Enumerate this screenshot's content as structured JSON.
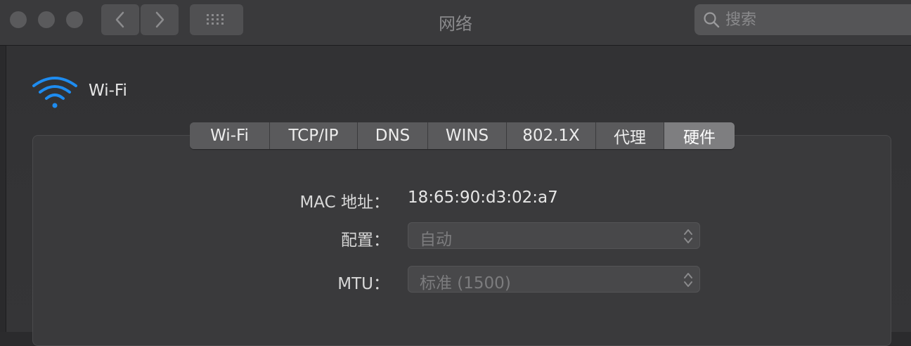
{
  "window": {
    "title": "网络",
    "search_placeholder": "搜索"
  },
  "interface": {
    "name": "Wi-Fi",
    "icon": "wifi-icon",
    "accent_color": "#1e8cf0"
  },
  "tabs": [
    {
      "label": "Wi-Fi",
      "active": false
    },
    {
      "label": "TCP/IP",
      "active": false
    },
    {
      "label": "DNS",
      "active": false
    },
    {
      "label": "WINS",
      "active": false
    },
    {
      "label": "802.1X",
      "active": false
    },
    {
      "label": "代理",
      "active": false
    },
    {
      "label": "硬件",
      "active": true
    }
  ],
  "hardware": {
    "mac_label": "MAC 地址：",
    "mac_value": "18:65:90:d3:02:a7",
    "config_label": "配置：",
    "config_value": "自动",
    "mtu_label": "MTU：",
    "mtu_value": "标准 (1500)"
  }
}
